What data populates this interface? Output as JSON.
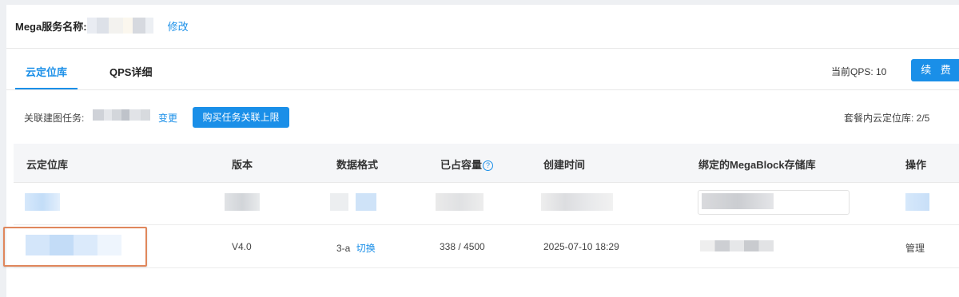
{
  "service": {
    "label": "Mega服务名称:",
    "edit_link": "修改"
  },
  "tabs": [
    {
      "label": "云定位库",
      "active": true
    },
    {
      "label": "QPS详细",
      "active": false
    }
  ],
  "qps": {
    "current_label": "当前QPS: 10",
    "renew_button": "续 费"
  },
  "task": {
    "label": "关联建图任务:",
    "change_link": "变更",
    "buy_button": "购买任务关联上限",
    "quota": "套餐内云定位库: 2/5"
  },
  "table": {
    "headers": [
      "云定位库",
      "版本",
      "数据格式",
      "已占容量",
      "创建时间",
      "绑定的MegaBlock存储库",
      "操作"
    ],
    "row2": {
      "version": "V4.0",
      "format": "3-a",
      "switch_link": "切换",
      "capacity": "338 / 4500",
      "created": "2025-07-10 18:29",
      "action": "管理"
    }
  },
  "colors": {
    "accent": "#1a8fe8",
    "highlight_border": "#e0875c"
  }
}
